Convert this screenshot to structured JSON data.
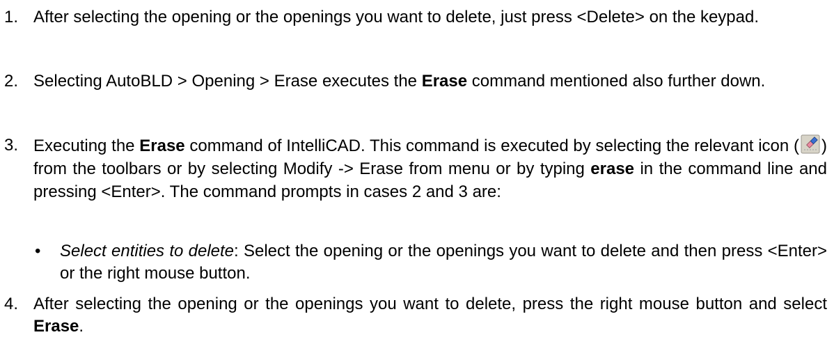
{
  "items": [
    {
      "number": "1.",
      "text": "After selecting the opening or the openings you want to delete, just press <Delete> on the keypad."
    },
    {
      "number": "2.",
      "text_before": "Selecting AutoBLD > Opening > Erase executes the ",
      "bold": "Erase",
      "text_after": " command mentioned also further down."
    },
    {
      "number": "3.",
      "text_before": "Executing the ",
      "bold_1": "Erase",
      "text_middle": " command of IntelliCAD. This command is executed by selecting the relevant icon (",
      "icon_name": "erase-icon",
      "text_after_icon": ") from the toolbars or by selecting Modify -> Erase from menu or by typing ",
      "bold_2": "erase",
      "text_end": " in the command line and pressing <Enter>. The command prompts in cases 2 and 3 are:",
      "bullet": {
        "symbol": "•",
        "italic": "Select entities to delete",
        "text": ": Select the opening or the openings you want to delete and then press <Enter> or the right mouse button."
      }
    },
    {
      "number": "4.",
      "text_before": "After selecting the opening or the openings you want to delete, press the right mouse button and select ",
      "bold": "Erase",
      "text_after": "."
    }
  ],
  "colors": {
    "text": "#000000",
    "background": "#ffffff",
    "icon_button": "#d8d4c8",
    "eraser_blue": "#3b6fd1",
    "eraser_pink": "#e98aa0",
    "pencil_line": "#b0b0b0"
  }
}
